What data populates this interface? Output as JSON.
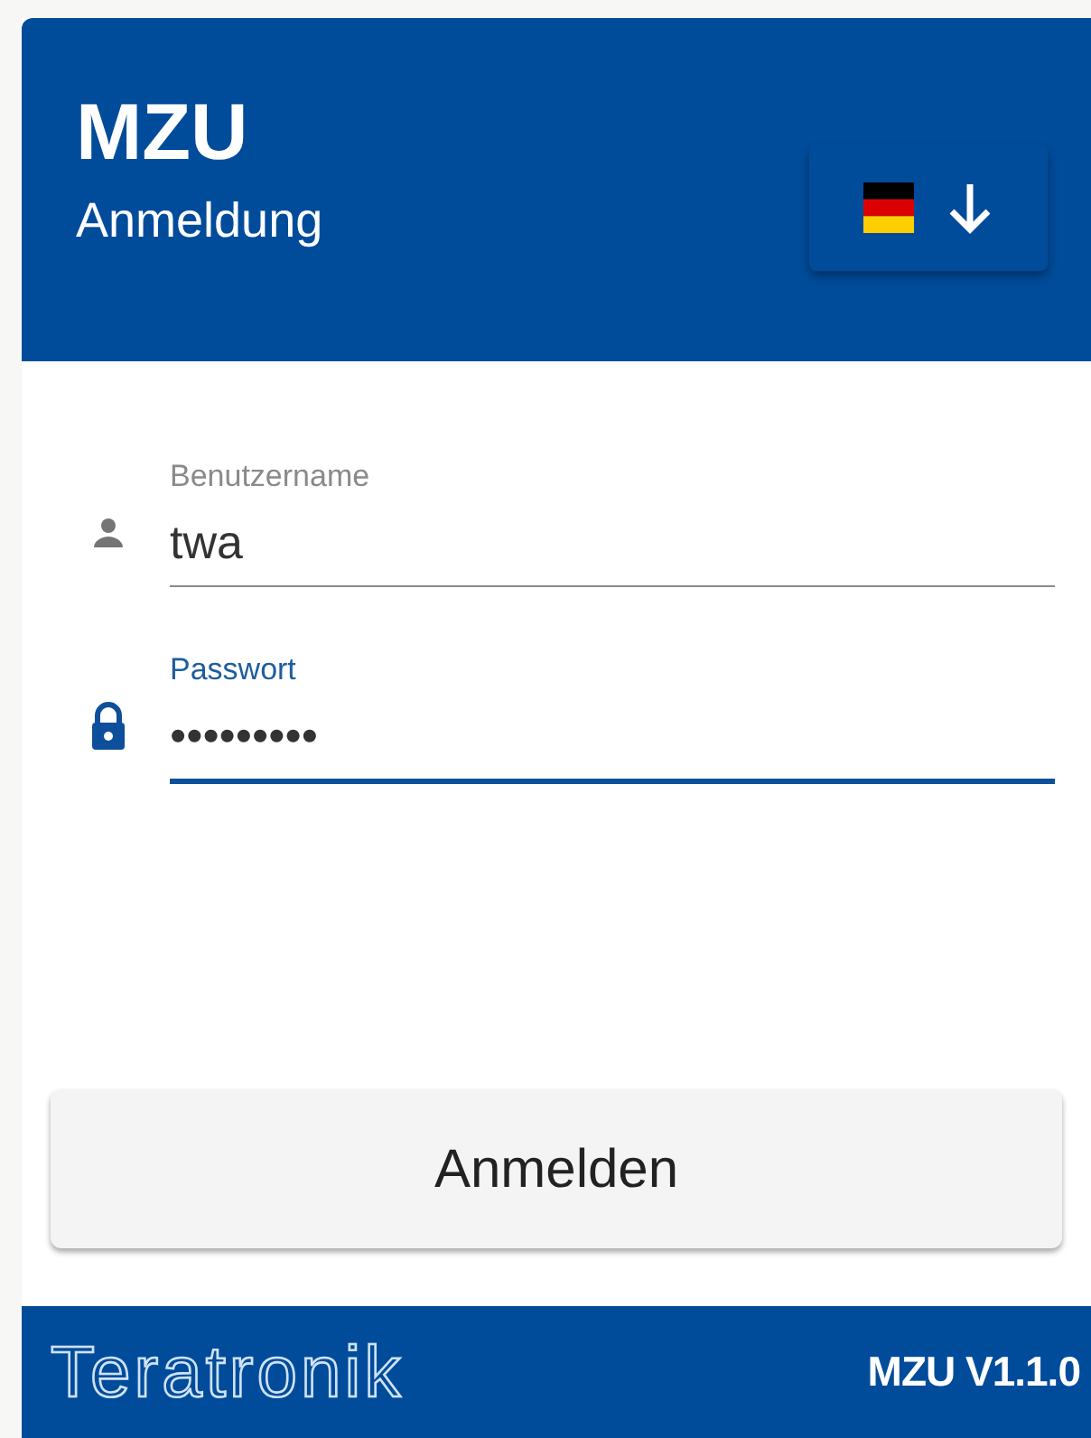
{
  "header": {
    "title": "MZU",
    "subtitle": "Anmeldung"
  },
  "fields": [
    {
      "kind": "user",
      "label": "Benutzername",
      "value": "twa",
      "focused": false
    },
    {
      "kind": "lock",
      "label": "Passwort",
      "value": "•••••••••",
      "focused": true
    }
  ],
  "submit": "Anmelden",
  "footer": {
    "logo": "Teratronik",
    "version": "MZU V1.1.0"
  }
}
